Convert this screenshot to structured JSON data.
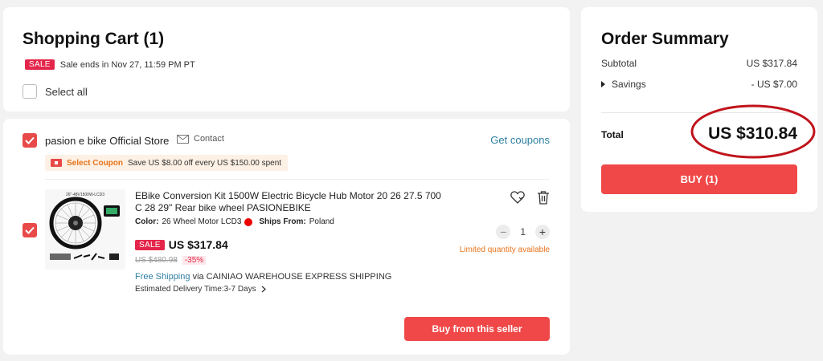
{
  "cart": {
    "title": "Shopping Cart (1)",
    "sale_tag": "SALE",
    "sale_text": "Sale ends in Nov 27, 11:59 PM PT",
    "select_all": "Select all"
  },
  "store": {
    "name": "pasion e bike Official Store",
    "contact": "Contact",
    "get_coupons": "Get coupons",
    "coupon_label": "Select Coupon",
    "coupon_text": "Save US $8.00 off every US $150.00 spent",
    "buy_from_seller": "Buy from this seller",
    "item": {
      "title": "EBike Conversion Kit 1500W Electric Bicycle Hub Motor 20 26 27.5 700 C 28 29\" Rear bike wheel PASIONEBIKE",
      "thumb_label": "26\"-48V1500W-LCD3",
      "color_label": "Color:",
      "color_value": "26 Wheel Motor LCD3",
      "ships_label": "Ships From:",
      "ships_value": "Poland",
      "sale_tag": "SALE",
      "price": "US $317.84",
      "original_price": "US $480.98",
      "discount": "-35%",
      "free_shipping": "Free Shipping",
      "shipping_via": "via CAINIAO WAREHOUSE EXPRESS SHIPPING",
      "delivery": "Estimated Delivery Time:3-7 Days",
      "quantity": "1",
      "limited": "Limited quantity available"
    }
  },
  "summary": {
    "title": "Order Summary",
    "subtotal_label": "Subtotal",
    "subtotal_value": "US $317.84",
    "savings_label": "Savings",
    "savings_value": "- US $7.00",
    "total_label": "Total",
    "total_value": "US $310.84",
    "buy_label": "BUY (1)"
  },
  "colors": {
    "accent_red": "#f04848",
    "sale_pink": "#e4264b",
    "link_blue": "#2f7fa3",
    "orange": "#e8731c",
    "annotation_circle": "#c0141c"
  },
  "icons": [
    "checkbox-checked-icon",
    "mail-icon",
    "coupon-icon",
    "heart-icon",
    "trash-icon",
    "chevron-right-icon",
    "caret-right-icon",
    "minus-icon",
    "plus-icon"
  ]
}
